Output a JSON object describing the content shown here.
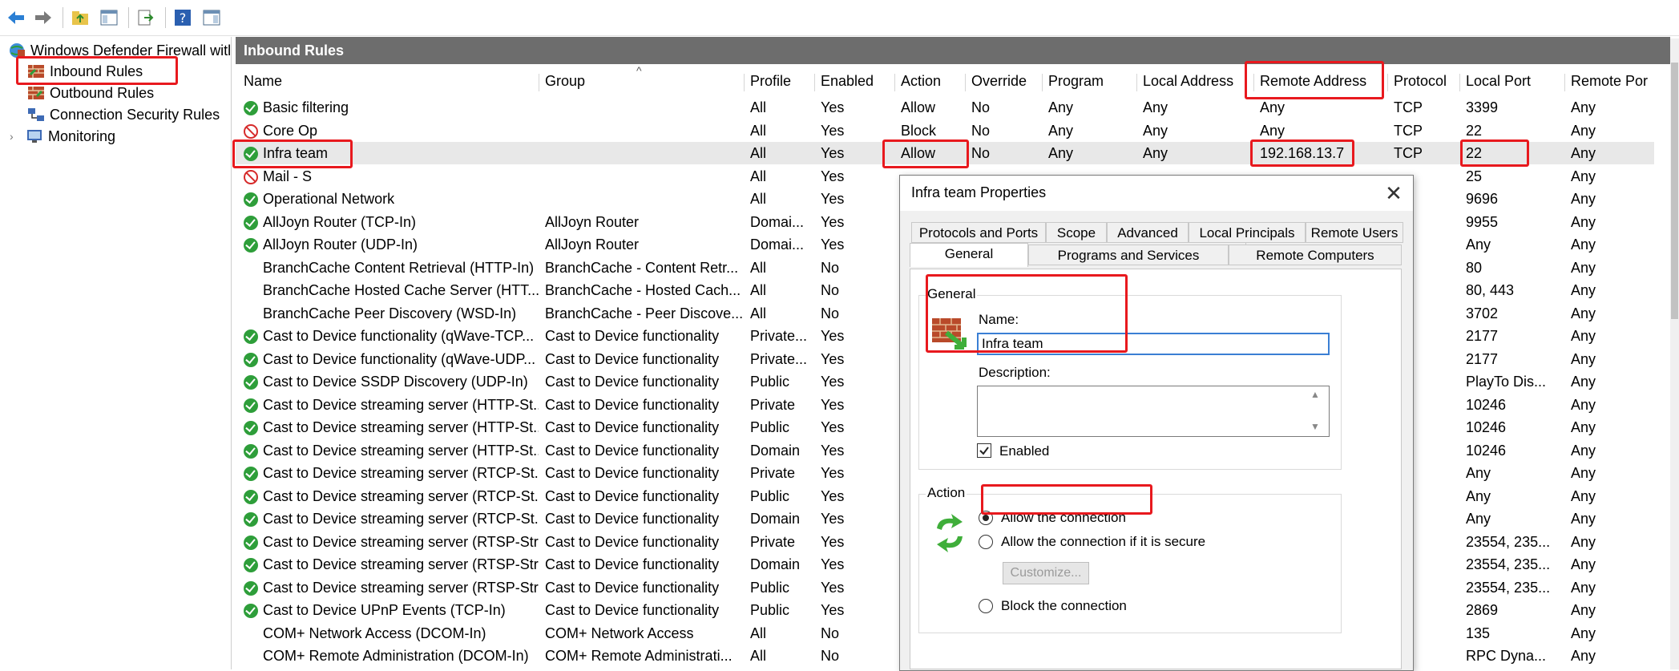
{
  "tree": {
    "root": "Windows Defender Firewall witl",
    "items": [
      {
        "label": "Inbound Rules"
      },
      {
        "label": "Outbound Rules"
      },
      {
        "label": "Connection Security Rules"
      },
      {
        "label": "Monitoring"
      }
    ]
  },
  "grid": {
    "title": "Inbound Rules",
    "columns": [
      "Name",
      "Group",
      "Profile",
      "Enabled",
      "Action",
      "Override",
      "Program",
      "Local Address",
      "Remote Address",
      "Protocol",
      "Local Port",
      "Remote Por"
    ],
    "rows": [
      {
        "status": "allow",
        "name": "Basic filtering",
        "group": "",
        "profile": "All",
        "enabled": "Yes",
        "action": "Allow",
        "override": "No",
        "program": "Any",
        "local_address": "Any",
        "remote_address": "Any",
        "protocol": "TCP",
        "local_port": "3399",
        "remote_port": "Any"
      },
      {
        "status": "block",
        "name": "Core Op",
        "group": "",
        "profile": "All",
        "enabled": "Yes",
        "action": "Block",
        "override": "No",
        "program": "Any",
        "local_address": "Any",
        "remote_address": "Any",
        "protocol": "TCP",
        "local_port": "22",
        "remote_port": "Any"
      },
      {
        "status": "allow",
        "name": "Infra team",
        "group": "",
        "profile": "All",
        "enabled": "Yes",
        "action": "Allow",
        "override": "No",
        "program": "Any",
        "local_address": "Any",
        "remote_address": "192.168.13.7",
        "protocol": "TCP",
        "local_port": "22",
        "remote_port": "Any",
        "selected": true
      },
      {
        "status": "block",
        "name": "Mail - S",
        "group": "",
        "profile": "All",
        "enabled": "Yes",
        "action": "",
        "override": "",
        "program": "",
        "local_address": "",
        "remote_address": "",
        "protocol": "",
        "local_port": "25",
        "remote_port": "Any"
      },
      {
        "status": "allow",
        "name": "Operational Network",
        "group": "",
        "profile": "All",
        "enabled": "Yes",
        "action": "",
        "override": "",
        "program": "",
        "local_address": "",
        "remote_address": "",
        "protocol": "",
        "local_port": "9696",
        "remote_port": "Any"
      },
      {
        "status": "allow",
        "name": "AllJoyn Router (TCP-In)",
        "group": "AllJoyn Router",
        "profile": "Domai...",
        "enabled": "Yes",
        "action": "",
        "override": "",
        "program": "",
        "local_address": "",
        "remote_address": "",
        "protocol": "",
        "local_port": "9955",
        "remote_port": "Any"
      },
      {
        "status": "allow",
        "name": "AllJoyn Router (UDP-In)",
        "group": "AllJoyn Router",
        "profile": "Domai...",
        "enabled": "Yes",
        "action": "",
        "override": "",
        "program": "",
        "local_address": "",
        "remote_address": "",
        "protocol": "",
        "local_port": "Any",
        "remote_port": "Any"
      },
      {
        "status": "none",
        "name": "BranchCache Content Retrieval (HTTP-In)",
        "group": "BranchCache - Content Retr...",
        "profile": "All",
        "enabled": "No",
        "action": "",
        "override": "",
        "program": "",
        "local_address": "",
        "remote_address": "",
        "protocol": "",
        "local_port": "80",
        "remote_port": "Any"
      },
      {
        "status": "none",
        "name": "BranchCache Hosted Cache Server (HTT...",
        "group": "BranchCache - Hosted Cach...",
        "profile": "All",
        "enabled": "No",
        "action": "",
        "override": "",
        "program": "",
        "local_address": "",
        "remote_address": "",
        "protocol": "",
        "local_port": "80, 443",
        "remote_port": "Any"
      },
      {
        "status": "none",
        "name": "BranchCache Peer Discovery (WSD-In)",
        "group": "BranchCache - Peer Discove...",
        "profile": "All",
        "enabled": "No",
        "action": "",
        "override": "",
        "program": "",
        "local_address": "",
        "remote_address": "",
        "protocol": "",
        "local_port": "3702",
        "remote_port": "Any"
      },
      {
        "status": "allow",
        "name": "Cast to Device functionality (qWave-TCP...",
        "group": "Cast to Device functionality",
        "profile": "Private...",
        "enabled": "Yes",
        "action": "",
        "override": "",
        "program": "",
        "local_address": "",
        "remote_address": "",
        "protocol": "",
        "local_port": "2177",
        "remote_port": "Any"
      },
      {
        "status": "allow",
        "name": "Cast to Device functionality (qWave-UDP...",
        "group": "Cast to Device functionality",
        "profile": "Private...",
        "enabled": "Yes",
        "action": "",
        "override": "",
        "program": "",
        "local_address": "",
        "remote_address": "",
        "protocol": "",
        "local_port": "2177",
        "remote_port": "Any"
      },
      {
        "status": "allow",
        "name": "Cast to Device SSDP Discovery (UDP-In)",
        "group": "Cast to Device functionality",
        "profile": "Public",
        "enabled": "Yes",
        "action": "",
        "override": "",
        "program": "",
        "local_address": "",
        "remote_address": "",
        "protocol": "",
        "local_port": "PlayTo Dis...",
        "remote_port": "Any"
      },
      {
        "status": "allow",
        "name": "Cast to Device streaming server (HTTP-St...",
        "group": "Cast to Device functionality",
        "profile": "Private",
        "enabled": "Yes",
        "action": "",
        "override": "",
        "program": "",
        "local_address": "",
        "remote_address": "",
        "protocol": "",
        "local_port": "10246",
        "remote_port": "Any"
      },
      {
        "status": "allow",
        "name": "Cast to Device streaming server (HTTP-St...",
        "group": "Cast to Device functionality",
        "profile": "Public",
        "enabled": "Yes",
        "action": "",
        "override": "",
        "program": "",
        "local_address": "",
        "remote_address": "",
        "protocol": "",
        "local_port": "10246",
        "remote_port": "Any"
      },
      {
        "status": "allow",
        "name": "Cast to Device streaming server (HTTP-St...",
        "group": "Cast to Device functionality",
        "profile": "Domain",
        "enabled": "Yes",
        "action": "",
        "override": "",
        "program": "",
        "local_address": "",
        "remote_address": "",
        "protocol": "",
        "local_port": "10246",
        "remote_port": "Any"
      },
      {
        "status": "allow",
        "name": "Cast to Device streaming server (RTCP-St...",
        "group": "Cast to Device functionality",
        "profile": "Private",
        "enabled": "Yes",
        "action": "",
        "override": "",
        "program": "",
        "local_address": "",
        "remote_address": "",
        "protocol": "",
        "local_port": "Any",
        "remote_port": "Any"
      },
      {
        "status": "allow",
        "name": "Cast to Device streaming server (RTCP-St...",
        "group": "Cast to Device functionality",
        "profile": "Public",
        "enabled": "Yes",
        "action": "",
        "override": "",
        "program": "",
        "local_address": "",
        "remote_address": "",
        "protocol": "",
        "local_port": "Any",
        "remote_port": "Any"
      },
      {
        "status": "allow",
        "name": "Cast to Device streaming server (RTCP-St...",
        "group": "Cast to Device functionality",
        "profile": "Domain",
        "enabled": "Yes",
        "action": "",
        "override": "",
        "program": "",
        "local_address": "",
        "remote_address": "",
        "protocol": "",
        "local_port": "Any",
        "remote_port": "Any"
      },
      {
        "status": "allow",
        "name": "Cast to Device streaming server (RTSP-Str...",
        "group": "Cast to Device functionality",
        "profile": "Private",
        "enabled": "Yes",
        "action": "",
        "override": "",
        "program": "",
        "local_address": "",
        "remote_address": "",
        "protocol": "",
        "local_port": "23554, 235...",
        "remote_port": "Any"
      },
      {
        "status": "allow",
        "name": "Cast to Device streaming server (RTSP-Str...",
        "group": "Cast to Device functionality",
        "profile": "Domain",
        "enabled": "Yes",
        "action": "",
        "override": "",
        "program": "",
        "local_address": "",
        "remote_address": "",
        "protocol": "",
        "local_port": "23554, 235...",
        "remote_port": "Any"
      },
      {
        "status": "allow",
        "name": "Cast to Device streaming server (RTSP-Str...",
        "group": "Cast to Device functionality",
        "profile": "Public",
        "enabled": "Yes",
        "action": "",
        "override": "",
        "program": "",
        "local_address": "",
        "remote_address": "",
        "protocol": "",
        "local_port": "23554, 235...",
        "remote_port": "Any"
      },
      {
        "status": "allow",
        "name": "Cast to Device UPnP Events (TCP-In)",
        "group": "Cast to Device functionality",
        "profile": "Public",
        "enabled": "Yes",
        "action": "",
        "override": "",
        "program": "",
        "local_address": "",
        "remote_address": "",
        "protocol": "",
        "local_port": "2869",
        "remote_port": "Any"
      },
      {
        "status": "none",
        "name": "COM+ Network Access (DCOM-In)",
        "group": "COM+ Network Access",
        "profile": "All",
        "enabled": "No",
        "action": "",
        "override": "",
        "program": "",
        "local_address": "",
        "remote_address": "",
        "protocol": "",
        "local_port": "135",
        "remote_port": "Any"
      },
      {
        "status": "none",
        "name": "COM+ Remote Administration (DCOM-In)",
        "group": "COM+ Remote Administrati...",
        "profile": "All",
        "enabled": "No",
        "action": "",
        "override": "",
        "program": "",
        "local_address": "",
        "remote_address": "",
        "protocol": "",
        "local_port": "RPC Dyna...",
        "remote_port": "Any"
      }
    ]
  },
  "dialog": {
    "title": "Infra team Properties",
    "tabs_row1": [
      "Protocols and Ports",
      "Scope",
      "Advanced",
      "Local Principals",
      "Remote Users"
    ],
    "tabs_row2": [
      "General",
      "Programs and Services",
      "Remote Computers"
    ],
    "general": {
      "group_title": "General",
      "name_label": "Name:",
      "name_value": "Infra team",
      "description_label": "Description:",
      "description_value": "",
      "enabled_label": "Enabled"
    },
    "action": {
      "group_title": "Action",
      "options": [
        "Allow the connection",
        "Allow the connection if it is secure",
        "Block the connection"
      ],
      "selected": "Allow the connection",
      "customize_label": "Customize..."
    }
  },
  "colors": {
    "accent_red": "#e8191e",
    "allow_green": "#2e9e3a",
    "block_red": "#d62b2b"
  }
}
